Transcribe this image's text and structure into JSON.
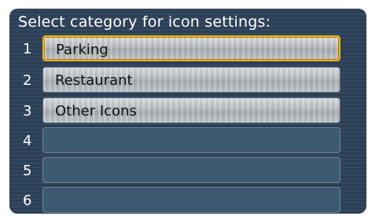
{
  "screen": {
    "title": "Select category for icon settings:"
  },
  "items": [
    {
      "number": "1",
      "label": "Parking"
    },
    {
      "number": "2",
      "label": "Restaurant"
    },
    {
      "number": "3",
      "label": "Other Icons"
    },
    {
      "number": "4",
      "label": ""
    },
    {
      "number": "5",
      "label": ""
    },
    {
      "number": "6",
      "label": ""
    }
  ],
  "colors": {
    "background": "#2b4056",
    "button": "#b9bec3",
    "empty_slot": "#3d5a72",
    "selection_highlight": "#f0b21a",
    "text_light": "#ffffff",
    "text_dark": "#111111"
  }
}
